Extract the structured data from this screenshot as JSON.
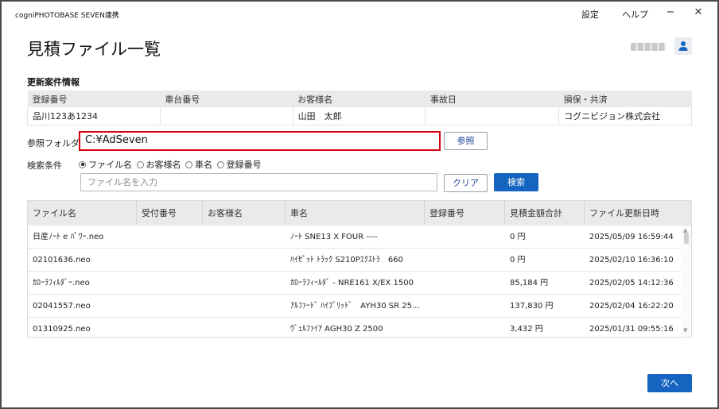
{
  "app": {
    "title": "cogniPHOTOBASE SEVEN連携",
    "menu": {
      "settings": "設定",
      "help": "ヘルプ"
    },
    "window": {
      "minimize": "−",
      "close": "✕"
    }
  },
  "page": {
    "title": "見積ファイル一覧"
  },
  "info": {
    "section_label": "更新案件情報",
    "headers": [
      "登録番号",
      "車台番号",
      "お客様名",
      "事故日",
      "損保・共済"
    ],
    "values": [
      "品川123あ1234",
      "",
      "山田　太郎",
      "",
      "コグニビジョン株式会社"
    ]
  },
  "folder": {
    "label": "参照フォルダ",
    "value": "C:¥AdSeven",
    "browse_label": "参照"
  },
  "search": {
    "label": "検索条件",
    "options": [
      "ファイル名",
      "お客様名",
      "車名",
      "登録番号"
    ],
    "selected_index": 0,
    "placeholder": "ファイル名を入力",
    "clear_label": "クリア",
    "search_label": "検索"
  },
  "files": {
    "columns": [
      "ファイル名",
      "受付番号",
      "お客様名",
      "車名",
      "登録番号",
      "見積金額合計",
      "ファイル更新日時"
    ],
    "rows": [
      [
        "日産ﾉｰﾄ e ﾊﾟﾜｰ.neo",
        "",
        "",
        "ﾉｰﾄ SNE13 X FOUR ----",
        "",
        "0 円",
        "2025/05/09 16:59:44"
      ],
      [
        "02101636.neo",
        "",
        "",
        "ﾊｲｾﾞｯﾄ ﾄﾗｯｸ S210Pｴｸｽﾄﾗ　660",
        "",
        "0 円",
        "2025/02/10 16:36:10"
      ],
      [
        "ｶﾛｰﾗﾌｨﾙﾀﾞｰ.neo",
        "",
        "",
        "ｶﾛｰﾗﾌｨｰﾙﾀﾞ - NRE161 X/EX 1500",
        "",
        "85,184 円",
        "2025/02/05 14:12:36"
      ],
      [
        "02041557.neo",
        "",
        "",
        "ｱﾙﾌｧｰﾄﾞ ﾊｲﾌﾞﾘｯﾄﾞ　AYH30 SR 25...",
        "",
        "137,830 円",
        "2025/02/04 16:22:20"
      ],
      [
        "01310925.neo",
        "",
        "",
        "ｳﾞｪﾙﾌｧｲｱ AGH30 Z 2500",
        "",
        "3,432 円",
        "2025/01/31 09:55:16"
      ]
    ]
  },
  "footer": {
    "next_label": "次へ"
  },
  "colors": {
    "accent": "#1565c0",
    "highlight_border": "#d9000d",
    "header_bg": "#e9eaec"
  }
}
